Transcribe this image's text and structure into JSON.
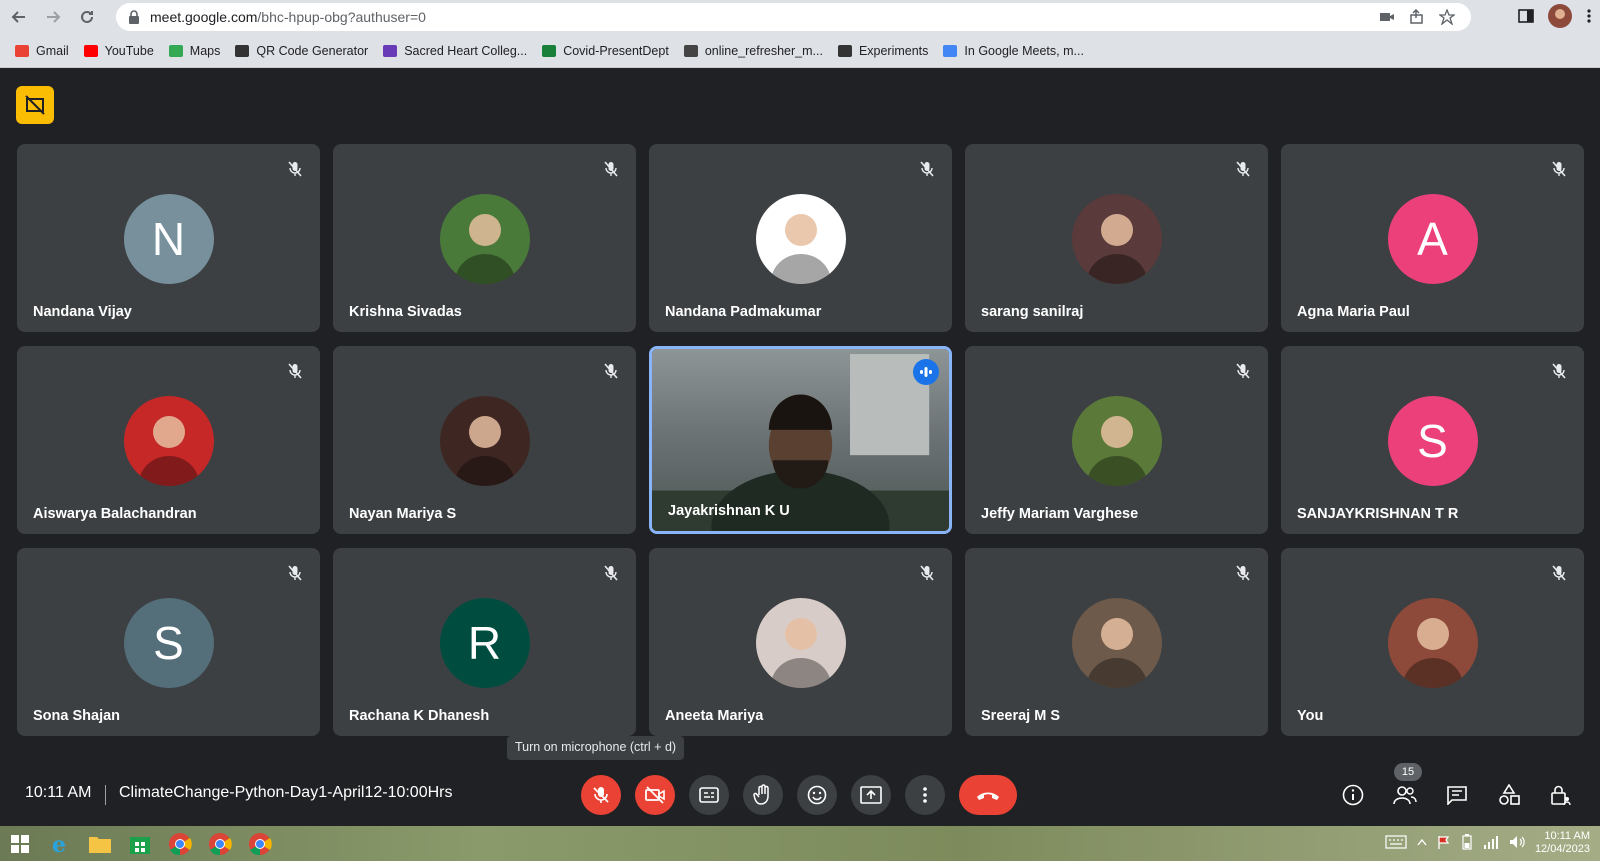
{
  "browser": {
    "url_host": "meet.google.com",
    "url_path": "/bhc-hpup-obg?authuser=0",
    "bookmarks": [
      {
        "label": "Gmail",
        "icon": "gmail-icon",
        "color": "#ea4335"
      },
      {
        "label": "YouTube",
        "icon": "youtube-icon",
        "color": "#ff0000"
      },
      {
        "label": "Maps",
        "icon": "maps-icon",
        "color": "#34a853"
      },
      {
        "label": "QR Code Generator",
        "icon": "qr-icon",
        "color": "#333333"
      },
      {
        "label": "Sacred Heart Colleg...",
        "icon": "forms-icon",
        "color": "#673ab7"
      },
      {
        "label": "Covid-PresentDept",
        "icon": "excel-icon",
        "color": "#188038"
      },
      {
        "label": "online_refresher_m...",
        "icon": "globe-icon",
        "color": "#444444"
      },
      {
        "label": "Experiments",
        "icon": "flask-icon",
        "color": "#333333"
      },
      {
        "label": "In Google Meets, m...",
        "icon": "google-icon",
        "color": "#4285f4"
      }
    ]
  },
  "participants": [
    {
      "name": "Nandana Vijay",
      "initial": "N",
      "avatar_color": "#78909c",
      "type": "initial"
    },
    {
      "name": "Krishna Sivadas",
      "initial": "",
      "avatar_color": "#4a7a3a",
      "type": "photo"
    },
    {
      "name": "Nandana Padmakumar",
      "initial": "",
      "avatar_color": "#ffffff",
      "type": "photo"
    },
    {
      "name": "sarang sanilraj",
      "initial": "",
      "avatar_color": "#5a3a3a",
      "type": "photo"
    },
    {
      "name": "Agna Maria Paul",
      "initial": "A",
      "avatar_color": "#ec407a",
      "type": "initial"
    },
    {
      "name": "Aiswarya Balachandran",
      "initial": "",
      "avatar_color": "#c62828",
      "type": "photo"
    },
    {
      "name": "Nayan Mariya S",
      "initial": "",
      "avatar_color": "#3e2723",
      "type": "photo"
    },
    {
      "name": "Jayakrishnan K U",
      "initial": "",
      "avatar_color": "#6d7476",
      "type": "video"
    },
    {
      "name": "Jeffy Mariam Varghese",
      "initial": "",
      "avatar_color": "#5b7a3a",
      "type": "photo"
    },
    {
      "name": "SANJAYKRISHNAN T R",
      "initial": "S",
      "avatar_color": "#ec407a",
      "type": "initial"
    },
    {
      "name": "Sona Shajan",
      "initial": "S",
      "avatar_color": "#546e7a",
      "type": "initial"
    },
    {
      "name": "Rachana K Dhanesh",
      "initial": "R",
      "avatar_color": "#004d40",
      "type": "initial"
    },
    {
      "name": "Aneeta Mariya",
      "initial": "",
      "avatar_color": "#d7ccc8",
      "type": "photo"
    },
    {
      "name": "Sreeraj M S",
      "initial": "",
      "avatar_color": "#6d5a4a",
      "type": "photo"
    },
    {
      "name": "You",
      "initial": "",
      "avatar_color": "#8d4a3a",
      "type": "photo"
    }
  ],
  "tooltip": "Turn on microphone (ctrl + d)",
  "bottombar": {
    "time": "10:11 AM",
    "meeting_title": "ClimateChange-Python-Day1-April12-10:00Hrs",
    "participant_count": "15"
  },
  "taskbar": {
    "time": "10:11 AM",
    "date": "12/04/2023"
  },
  "colors": {
    "background": "#202124",
    "tile": "#3c4043",
    "danger": "#ea4335",
    "active_border": "#8ab4f8",
    "speaking": "#1a73e8"
  }
}
